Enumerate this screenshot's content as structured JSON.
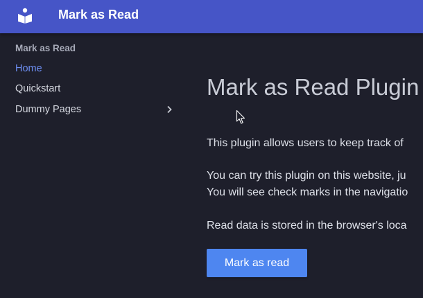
{
  "header": {
    "site_title": "Mark as Read",
    "logo_icon": "reader-book-icon",
    "background_color": "#4655c7"
  },
  "sidebar": {
    "title": "Mark as Read",
    "items": [
      {
        "label": "Home",
        "active": true
      },
      {
        "label": "Quickstart",
        "active": false
      },
      {
        "label": "Dummy Pages",
        "active": false,
        "icon": "chevron-right-icon"
      }
    ],
    "active_color": "#6d8ef2"
  },
  "main": {
    "title": "Mark as Read Plugin",
    "paragraphs": [
      "This plugin allows users to keep track of",
      "You can try this plugin on this website, ju",
      "You will see check marks in the navigatio",
      "Read data is stored in the browser's loca"
    ],
    "button_label": "Mark as read",
    "button_color": "#4e86f0"
  }
}
